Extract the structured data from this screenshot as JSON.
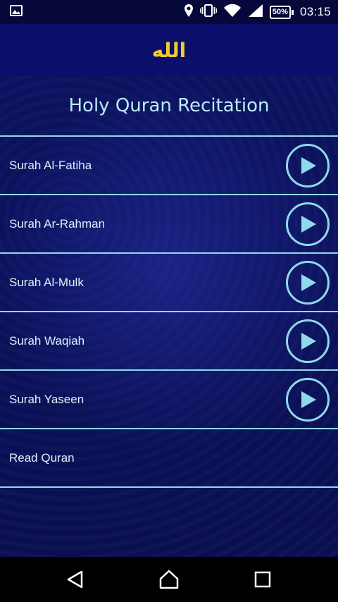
{
  "status_bar": {
    "battery_percent": "50%",
    "time": "03:15",
    "icons": [
      "gallery-icon",
      "location-icon",
      "vibrate-icon",
      "wifi-icon",
      "signal-icon",
      "battery-icon"
    ]
  },
  "app_bar": {
    "logo_text": "الله",
    "logo_color": "#f0cc2c",
    "background": "#0b0f6b"
  },
  "main": {
    "title": "Holy Quran Recitation",
    "items": [
      {
        "label": "Surah Al-Fatiha",
        "has_play": true
      },
      {
        "label": "Surah Ar-Rahman",
        "has_play": true
      },
      {
        "label": "Surah Al-Mulk",
        "has_play": true
      },
      {
        "label": "Surah Waqiah",
        "has_play": true
      },
      {
        "label": "Surah Yaseen",
        "has_play": true
      },
      {
        "label": "Read Quran",
        "has_play": false
      }
    ]
  },
  "nav_bar": {
    "buttons": [
      "back-icon",
      "home-icon",
      "recents-icon"
    ]
  },
  "colors": {
    "accent": "#8fd9ea",
    "text": "#d9f4fb"
  }
}
